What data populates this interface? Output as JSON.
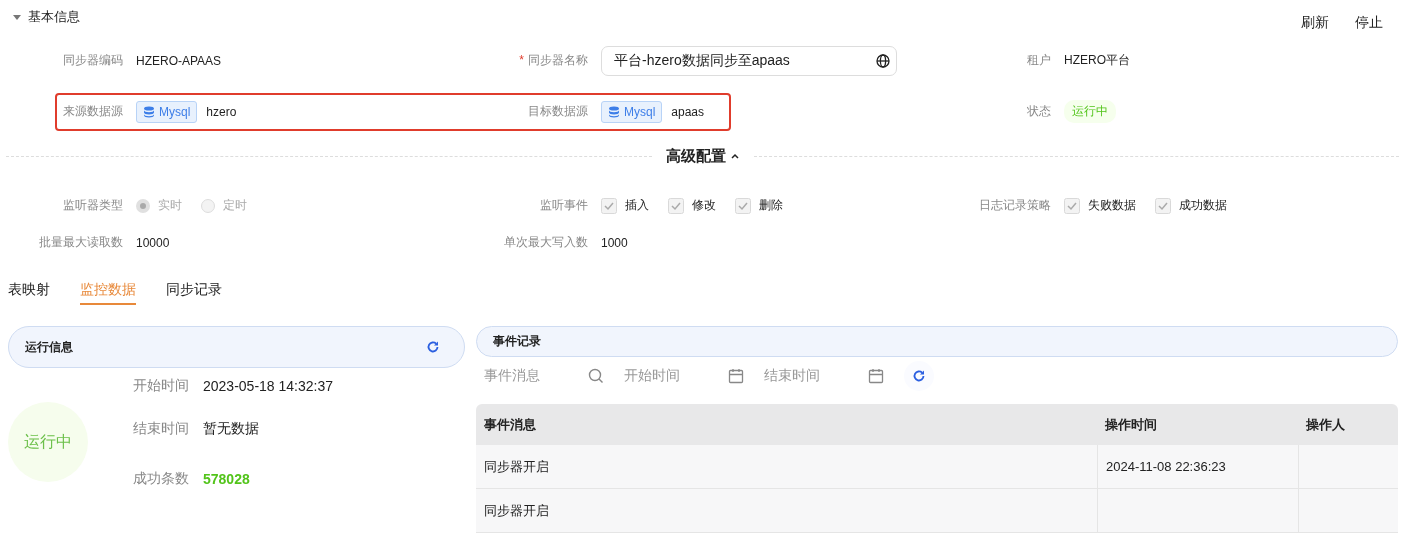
{
  "section": {
    "title": "基本信息",
    "expanded": true
  },
  "actions": [
    "刷新",
    "停止"
  ],
  "info_rows": [
    {
      "fields": [
        {
          "kind": "text",
          "label": "同步器编码",
          "value": "HZERO-APAAS"
        },
        {
          "kind": "input",
          "label": "同步器名称",
          "required_mark": "*",
          "value": "平台-hzero数据同步至apaas"
        },
        {
          "kind": "text",
          "label": "租户",
          "value": "HZERO平台"
        }
      ]
    },
    {
      "highlight": true,
      "fields": [
        {
          "kind": "source",
          "label": "来源数据源",
          "tag": "Mysql",
          "value": "hzero"
        },
        {
          "kind": "source",
          "label": "目标数据源",
          "tag": "Mysql",
          "value": "apaas"
        },
        {
          "kind": "status",
          "label": "状态",
          "value": "运行中"
        }
      ]
    }
  ],
  "advanced": {
    "title": "高级配置",
    "expanded": true,
    "rows": [
      [
        {
          "kind": "radio",
          "label": "监听器类型",
          "options": [
            {
              "label": "实时",
              "selected": true
            },
            {
              "label": "定时",
              "selected": false
            }
          ]
        },
        {
          "kind": "checks",
          "label": "监听事件",
          "options": [
            {
              "label": "插入",
              "checked": true
            },
            {
              "label": "修改",
              "checked": true
            },
            {
              "label": "删除",
              "checked": true
            }
          ]
        },
        {
          "kind": "checks",
          "label": "日志记录策略",
          "options": [
            {
              "label": "失败数据",
              "checked": true
            },
            {
              "label": "成功数据",
              "checked": true
            }
          ]
        }
      ],
      [
        {
          "kind": "text",
          "label": "批量最大读取数",
          "value": "10000"
        },
        {
          "kind": "text",
          "label": "单次最大写入数",
          "value": "1000"
        }
      ]
    ]
  },
  "tabs": [
    {
      "label": "表映射",
      "selected": false
    },
    {
      "label": "监控数据",
      "selected": true
    },
    {
      "label": "同步记录",
      "selected": false
    }
  ],
  "run_panel": {
    "title": "运行信息",
    "status": "运行中",
    "fields": [
      {
        "label": "开始时间",
        "value": "2023-05-18 14:32:37",
        "color": "#222222"
      },
      {
        "label": "结束时间",
        "value": "暂无数据",
        "color": "#222222"
      },
      {
        "label": "成功条数",
        "value": "578028",
        "color": "#52c41a"
      }
    ]
  },
  "events": {
    "title": "事件记录",
    "filters": [
      {
        "kind": "search",
        "placeholder": "事件消息"
      },
      {
        "kind": "date",
        "placeholder": "开始时间"
      },
      {
        "kind": "date",
        "placeholder": "结束时间"
      }
    ],
    "columns": [
      "事件消息",
      "操作时间",
      "操作人"
    ],
    "rows": [
      {
        "message": "同步器开启",
        "time": "2024-11-08 22:36:23"
      },
      {
        "message": "同步器开启"
      }
    ]
  }
}
